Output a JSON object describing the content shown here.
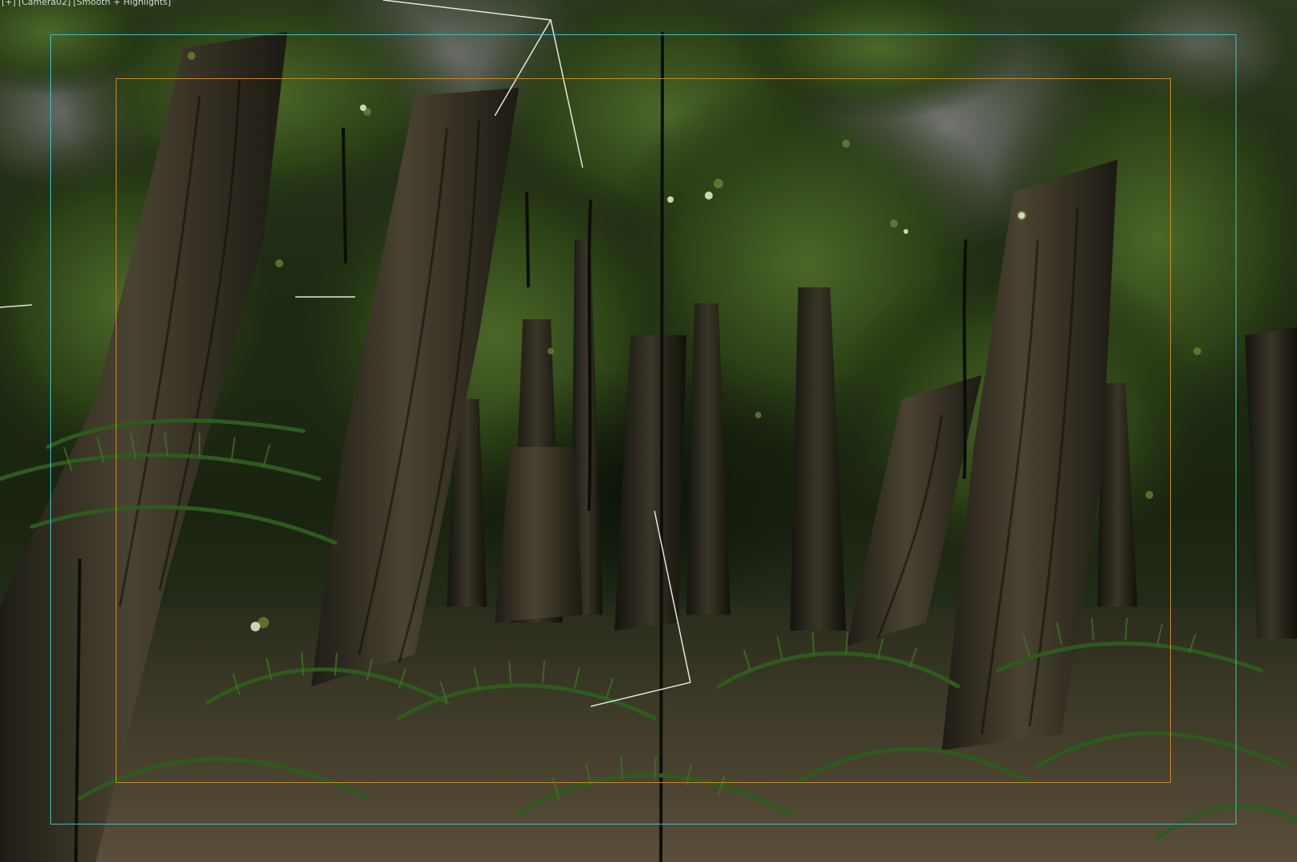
{
  "viewport": {
    "label_parts": [
      "[+]",
      "[Camera02]",
      "[Smooth + Highlights]"
    ]
  },
  "colors": {
    "action_safe_frame": "#3fbfc4",
    "title_safe_frame": "#c58a2a",
    "foliage_dark": "#1d2a12",
    "foliage_light": "#4f6a2a",
    "bark": "#3e3628",
    "fern": "#2f5a1e",
    "ground": "#5a4e3a",
    "sky_gray": "#7d7d7d"
  },
  "scene": {
    "type": "3d-viewport-render",
    "subject": "dense jungle forest",
    "icons": [
      "camera-target-line-icon"
    ]
  }
}
